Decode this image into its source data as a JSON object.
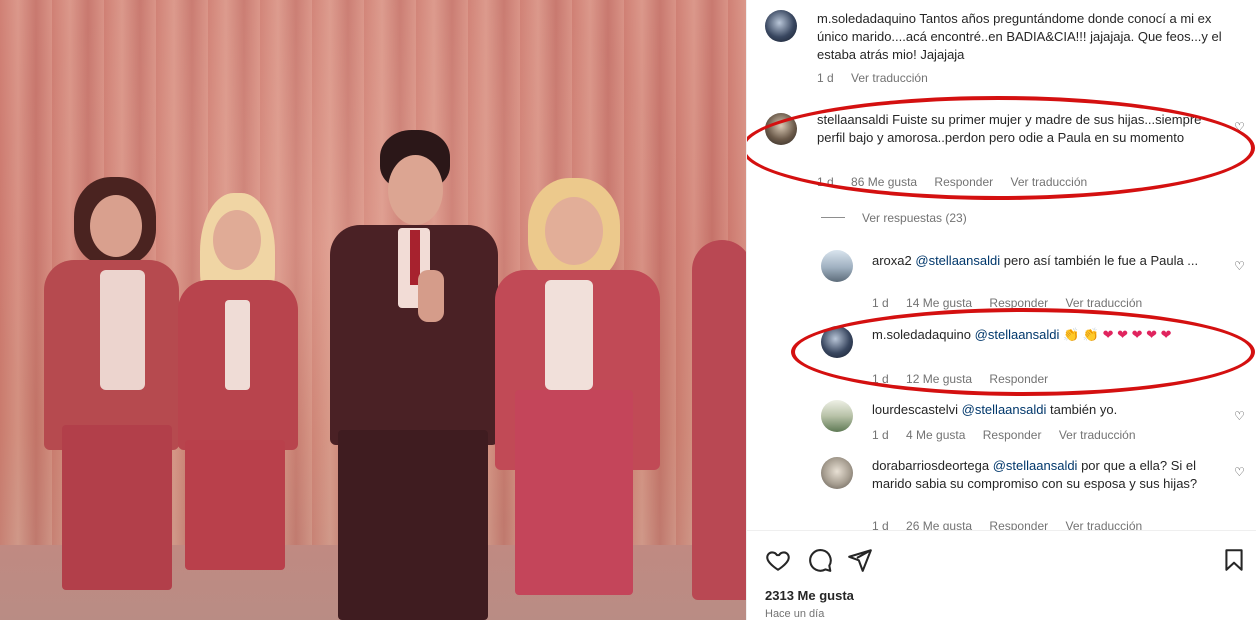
{
  "post": {
    "caption_user": "m.soledadaquino",
    "caption_text": "Tantos años preguntándome donde conocí a mi ex único marido....acá encontré..en BADIA&CIA!!! jajajaja. Que feos...y el estaba atrás mio! Jajajaja",
    "caption_time": "1 d",
    "caption_translate": "Ver traducción",
    "likes": "2313 Me gusta",
    "time_ago": "Hace un día"
  },
  "comments": [
    {
      "user": "stellaansaldi",
      "text": "Fuiste su primer mujer y madre de sus hijas...siempre perfil bajo y amorosa..perdon pero odie a Paula en su momento",
      "time": "1 d",
      "likes": "86 Me gusta",
      "reply": "Responder",
      "translate": "Ver traducción",
      "view_replies": "Ver respuestas (23)"
    },
    {
      "user": "aroxa2",
      "mention": "@stellaansaldi",
      "text": "pero así también le fue a Paula ...",
      "time": "1 d",
      "likes": "14 Me gusta",
      "reply": "Responder",
      "translate": "Ver traducción"
    },
    {
      "user": "m.soledadaquino",
      "mention": "@stellaansaldi",
      "text": "👏 👏 ❤ ❤ ❤ ❤ ❤",
      "time": "1 d",
      "likes": "12 Me gusta",
      "reply": "Responder"
    },
    {
      "user": "lourdescastelvi",
      "mention": "@stellaansaldi",
      "text": "también yo.",
      "time": "1 d",
      "likes": "4 Me gusta",
      "reply": "Responder",
      "translate": "Ver traducción"
    },
    {
      "user": "dorabarriosdeortega",
      "mention": "@stellaansaldi",
      "text": "por que a ella? Si el marido sabia su compromiso con su esposa y sus hijas?",
      "time": "1 d",
      "likes": "26 Me gusta",
      "reply": "Responder",
      "translate": "Ver traducción"
    }
  ],
  "icons": [
    "heart-icon",
    "comment-icon",
    "share-icon",
    "bookmark-icon"
  ],
  "colors": {
    "annotation": "#d41010",
    "link": "#00376b",
    "muted": "#737373"
  }
}
